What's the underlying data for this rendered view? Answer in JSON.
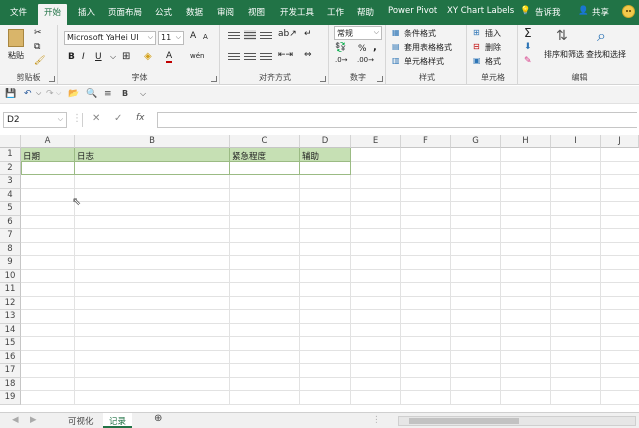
{
  "ribbon_tabs": [
    {
      "label": "文件",
      "active": false
    },
    {
      "label": "开始",
      "active": true
    },
    {
      "label": "插入",
      "active": false
    },
    {
      "label": "页面布局",
      "active": false
    },
    {
      "label": "公式",
      "active": false
    },
    {
      "label": "数据",
      "active": false
    },
    {
      "label": "审阅",
      "active": false
    },
    {
      "label": "视图",
      "active": false
    },
    {
      "label": "开发工具",
      "active": false
    },
    {
      "label": "工作",
      "active": false
    },
    {
      "label": "帮助",
      "active": false
    },
    {
      "label": "Power Pivot",
      "active": false
    },
    {
      "label": "XY Chart Labels",
      "active": false
    }
  ],
  "tell_me": "告诉我",
  "share": "共享",
  "clipboard": {
    "paste": "粘贴",
    "group": "剪贴板"
  },
  "font": {
    "name": "Microsoft YaHei UI",
    "size": "11",
    "bold": "B",
    "italic": "I",
    "underline": "U",
    "group": "字体",
    "grow": "A",
    "shrink": "A",
    "color_letter": "A",
    "phonetic": "wén"
  },
  "alignment": {
    "group": "对齐方式"
  },
  "number": {
    "format": "常规",
    "percent": "%",
    "comma": ",",
    "group": "数字"
  },
  "styles": {
    "conditional": "条件格式",
    "table": "套用表格格式",
    "cell": "单元格样式",
    "group": "样式"
  },
  "cells": {
    "insert": "插入",
    "delete": "删除",
    "format": "格式",
    "group": "单元格"
  },
  "editing": {
    "sort": "排序和筛选",
    "find": "查找和选择",
    "group": "编辑"
  },
  "qat": {
    "bold": "B"
  },
  "formula_bar": {
    "name_box": "D2",
    "fx": "fx",
    "content": ""
  },
  "columns": [
    "A",
    "B",
    "C",
    "D",
    "E",
    "F",
    "G",
    "H",
    "I",
    "J"
  ],
  "rows": [
    "1",
    "2",
    "3",
    "4",
    "5",
    "6",
    "7",
    "8",
    "9",
    "10",
    "11",
    "12",
    "13",
    "14",
    "15",
    "16",
    "17",
    "18",
    "19"
  ],
  "cells_data": {
    "A1": "日期",
    "B1": "日志",
    "C1": "紧急程度",
    "D1": "辅助"
  },
  "sheets": [
    {
      "label": "可视化",
      "active": false
    },
    {
      "label": "记录",
      "active": true
    }
  ],
  "colors": {
    "excel_green": "#217346",
    "header_fill": "#c6e0b4"
  }
}
